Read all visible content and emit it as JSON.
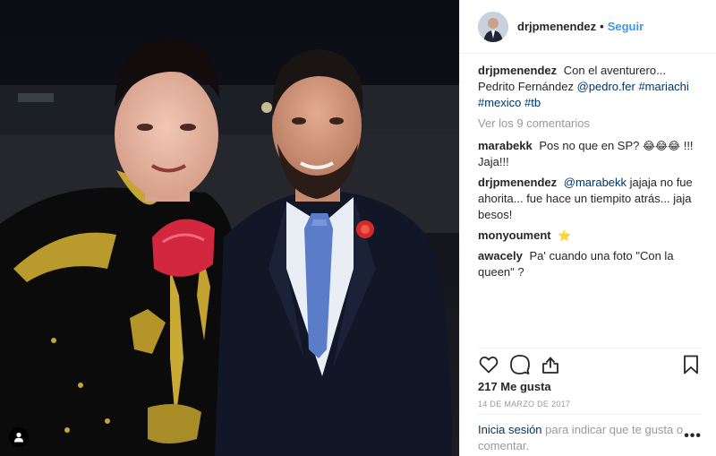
{
  "post": {
    "username": "drjpmenendez",
    "separator": "•",
    "follow_label": "Seguir"
  },
  "caption": {
    "username": "drjpmenendez",
    "text": "Con el aventurero... Pedrito Fernández",
    "mention": "@pedro.fer",
    "hashtags": "#mariachi #mexico #tb"
  },
  "view_all_label": "Ver los 9 comentarios",
  "comments": [
    {
      "username": "marabekk",
      "text": "Pos no que en SP?",
      "emoji": "😂😂😂",
      "text2": "!!! Jaja!!!"
    },
    {
      "username": "drjpmenendez",
      "mention": "@marabekk",
      "text": "jajaja no fue ahorita... fue hace un tiempito atrás... jaja besos!"
    },
    {
      "username": "monyoument",
      "emoji": "⭐"
    },
    {
      "username": "awacely",
      "text": "Pa' cuando una foto \"Con la queen\" ?"
    }
  ],
  "likes_label": "217 Me gusta",
  "date_label": "14 DE MARZO DE 2017",
  "login": {
    "link": "Inicia sesión",
    "text": "para indicar que te gusta o comentar."
  },
  "more_label": "•••",
  "icons": {
    "like": "heart-icon",
    "comment": "comment-bubble-icon",
    "share": "share-icon",
    "save": "bookmark-icon",
    "tag": "user-tag-icon"
  },
  "colors": {
    "link_blue": "#3897f0",
    "dark_link": "#003569",
    "muted": "#999999",
    "text": "#262626"
  }
}
